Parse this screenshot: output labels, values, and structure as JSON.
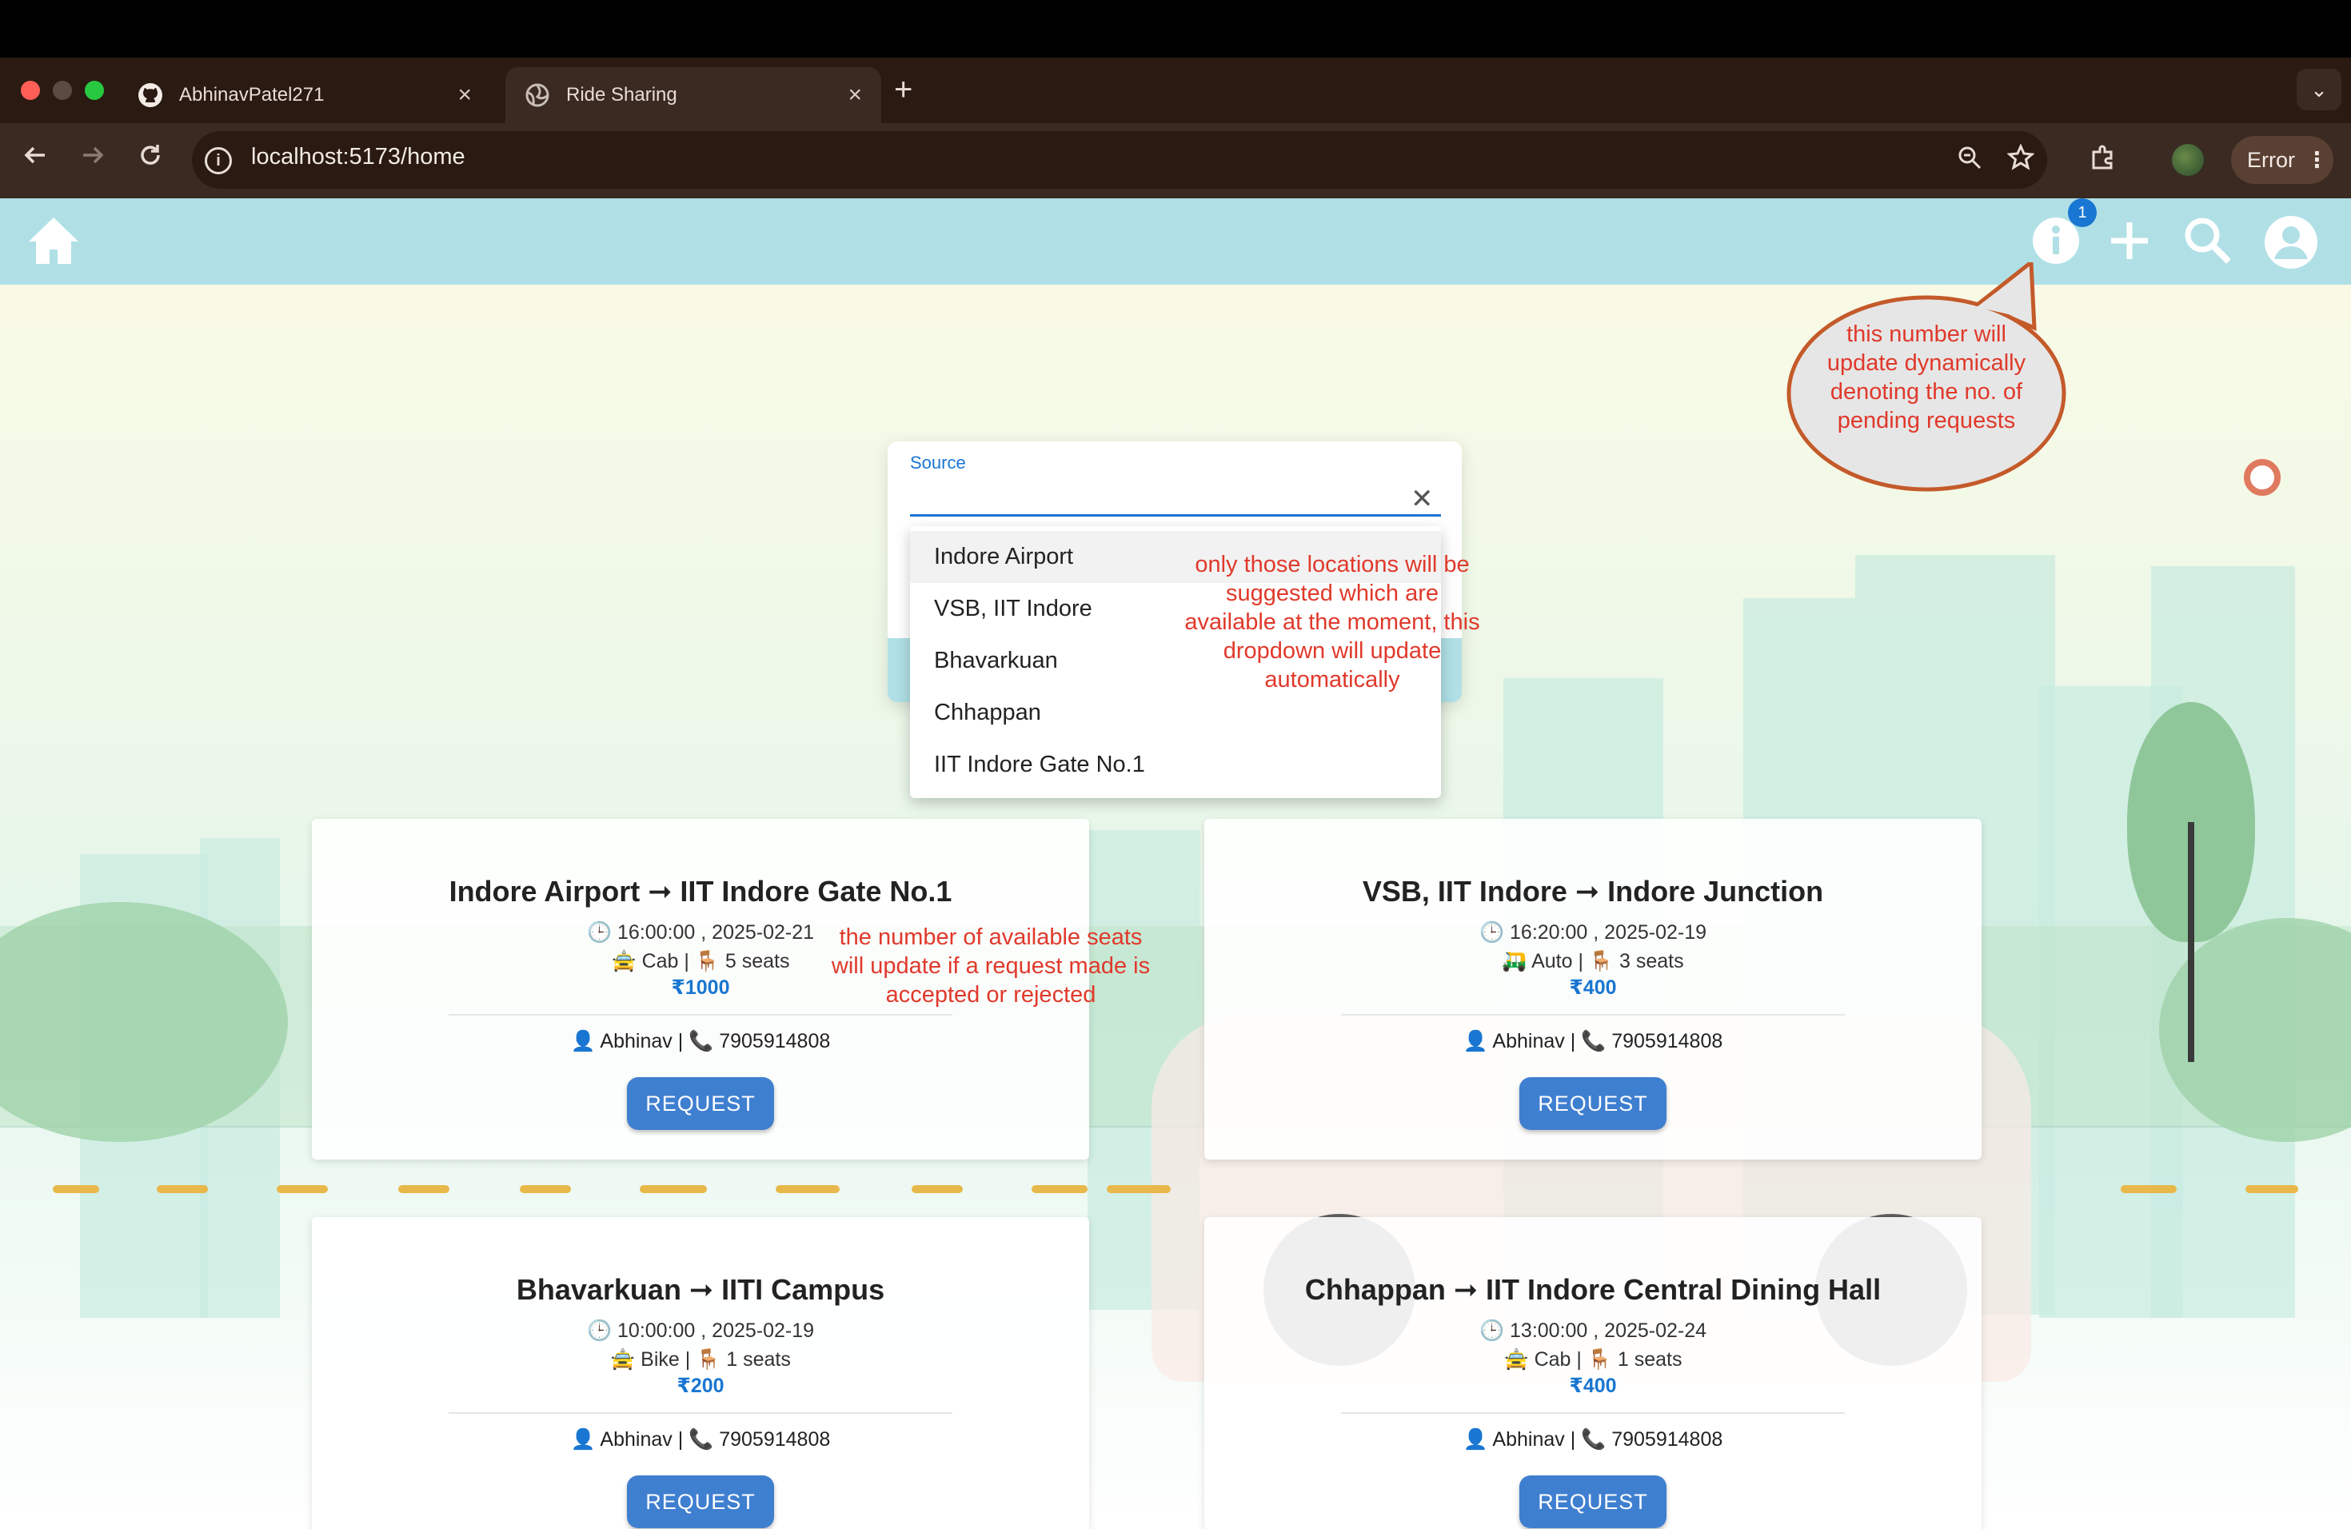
{
  "browser": {
    "tabs": [
      {
        "title": "AbhinavPatel271",
        "icon": "github-icon"
      },
      {
        "title": "Ride Sharing",
        "icon": "globe-icon"
      }
    ],
    "new_tab_label": "+",
    "url": "localhost:5173/home",
    "status_label": "Error"
  },
  "appbar": {
    "notification_count": "1",
    "icons": [
      "home-icon",
      "info-icon",
      "add-icon",
      "search-icon",
      "account-icon"
    ]
  },
  "annotations": {
    "badge_note": "this number will update dynamically denoting the no. of pending requests",
    "dropdown_note": "only those locations will be suggested which are available at the moment, this dropdown will update automatically",
    "seats_note": "the number of available seats will update if a request made is accepted or rejected"
  },
  "source": {
    "label": "Source",
    "value": "",
    "options": [
      "Indore Airport",
      "VSB, IIT Indore",
      "Bhavarkuan",
      "Chhappan",
      "IIT Indore Gate No.1"
    ],
    "highlighted_index": 0
  },
  "rides": [
    {
      "route": "Indore Airport ➞ IIT Indore Gate No.1",
      "time": "🕒 16:00:00 , 2025-02-21",
      "vehicle": "🚖 Cab | 🪑 5 seats",
      "price": "₹1000",
      "contact": "👤 Abhinav | 📞 7905914808",
      "button": "REQUEST"
    },
    {
      "route": "VSB, IIT Indore ➞ Indore Junction",
      "time": "🕒 16:20:00 , 2025-02-19",
      "vehicle": "🛺 Auto | 🪑 3 seats",
      "price": "₹400",
      "contact": "👤 Abhinav | 📞 7905914808",
      "button": "REQUEST"
    },
    {
      "route": "Bhavarkuan ➞ IITI Campus",
      "time": "🕒 10:00:00 , 2025-02-19",
      "vehicle": "🚖 Bike | 🪑 1 seats",
      "price": "₹200",
      "contact": "👤 Abhinav | 📞 7905914808",
      "button": "REQUEST"
    },
    {
      "route": "Chhappan ➞ IIT Indore Central Dining Hall",
      "time": "🕒 13:00:00 , 2025-02-24",
      "vehicle": "🚖 Cab | 🪑 1 seats",
      "price": "₹400",
      "contact": "👤 Abhinav | 📞 7905914808",
      "button": "REQUEST"
    }
  ],
  "colors": {
    "appbar": "#b0e0e6",
    "accent": "#1976d2",
    "button": "#3f7fd0",
    "annotation": "#e0392b"
  }
}
